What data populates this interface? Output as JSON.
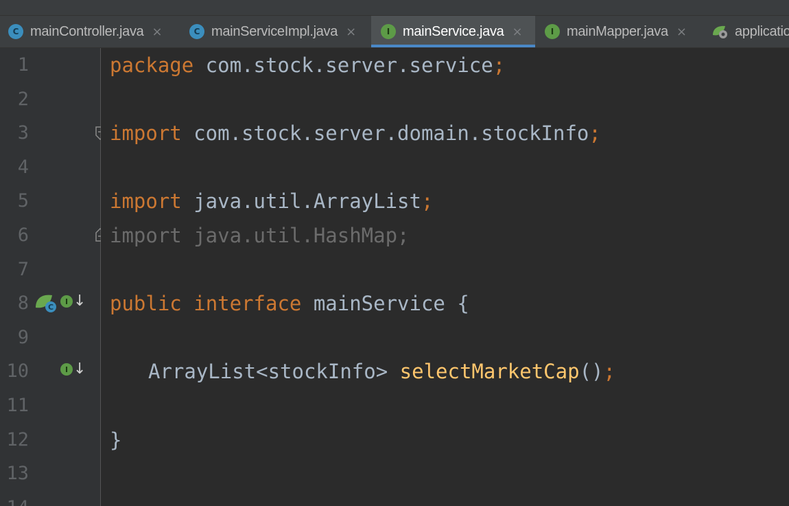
{
  "tabs": [
    {
      "label": "mainController.java",
      "icon": "class-icon",
      "active": false
    },
    {
      "label": "mainServiceImpl.java",
      "icon": "class-icon",
      "active": false
    },
    {
      "label": "mainService.java",
      "icon": "interface-icon",
      "active": true
    },
    {
      "label": "mainMapper.java",
      "icon": "interface-icon",
      "active": false
    },
    {
      "label": "applicatio",
      "icon": "spring-config-icon",
      "active": false
    }
  ],
  "tab_close_glyph": "×",
  "icon_letters": {
    "class": "C",
    "interface": "I"
  },
  "line_numbers": [
    "1",
    "2",
    "3",
    "4",
    "5",
    "6",
    "7",
    "8",
    "9",
    "10",
    "11",
    "12",
    "13",
    "14"
  ],
  "code": {
    "l1": {
      "kw": "package",
      "text": " com.stock.server.service",
      "semi": ";"
    },
    "l3": {
      "kw": "import",
      "text": " com.stock.server.domain.stockInfo",
      "semi": ";"
    },
    "l5": {
      "kw": "import",
      "text": " java.util.ArrayList",
      "semi": ";"
    },
    "l6": {
      "kw": "import",
      "text": " java.util.HashMap",
      "semi": ";"
    },
    "l8": {
      "kw1": "public",
      "kw2": "interface",
      "text": " mainService {"
    },
    "l10": {
      "type": "ArrayList<stockInfo> ",
      "method": "selectMarketCap",
      "parens": "()",
      "semi": ";"
    },
    "l12": {
      "text": "}"
    }
  },
  "colors": {
    "keyword": "#cc7832",
    "method": "#ffc66d",
    "text": "#a9b7c6",
    "background": "#2b2b2b",
    "active_tab_underline": "#4a88c7"
  }
}
